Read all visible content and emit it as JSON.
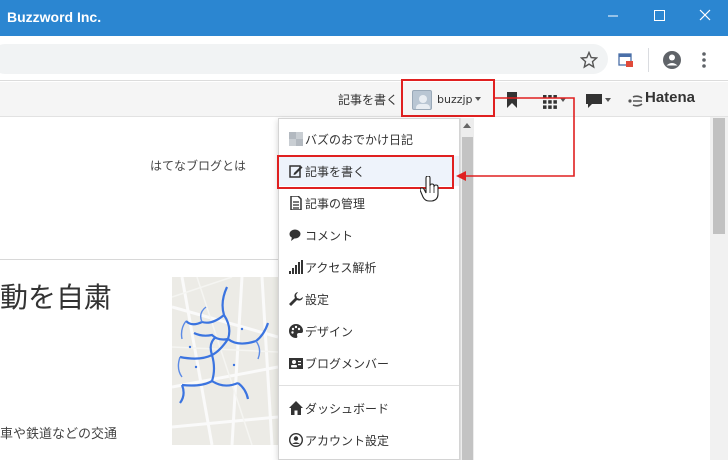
{
  "window": {
    "title": "Buzzword Inc.",
    "controls": [
      "minimize-icon",
      "maximize-icon",
      "close-icon"
    ]
  },
  "browser_toolbar": {
    "icons": [
      "star-icon",
      "extension-icon",
      "profile-icon",
      "kebab-menu-icon"
    ]
  },
  "hatena_bar": {
    "write_link": "記事を書く",
    "username": "buzzjp",
    "logo": "Hatena",
    "icons": [
      "bookmark-icon",
      "apps-grid-icon",
      "chat-icon",
      "hatena-logo-mark"
    ]
  },
  "page": {
    "about_link": "はてなブログとは",
    "headline": "動を自粛",
    "body_snippet": "車や鉄道などの交通"
  },
  "dropdown": {
    "items": [
      {
        "label": "バズのおでかけ日記",
        "icon": "blog-icon"
      },
      {
        "label": "記事を書く",
        "icon": "edit-icon"
      },
      {
        "label": "記事の管理",
        "icon": "document-icon"
      },
      {
        "label": "コメント",
        "icon": "comment-icon"
      },
      {
        "label": "アクセス解析",
        "icon": "analytics-icon"
      },
      {
        "label": "設定",
        "icon": "wrench-icon"
      },
      {
        "label": "デザイン",
        "icon": "palette-icon"
      },
      {
        "label": "ブログメンバー",
        "icon": "member-icon"
      },
      {
        "label": "ダッシュボード",
        "icon": "home-icon"
      },
      {
        "label": "アカウント設定",
        "icon": "account-icon"
      }
    ]
  },
  "colors": {
    "titlebar": "#2b86d1",
    "highlight": "#e02020",
    "map_route": "#3b74e0"
  }
}
